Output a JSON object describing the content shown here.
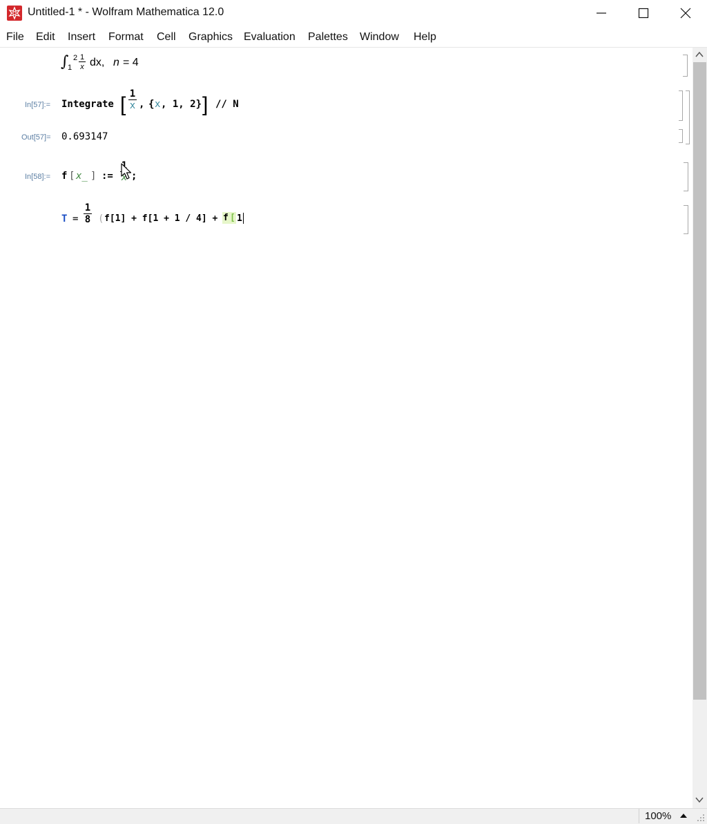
{
  "window": {
    "title": "Untitled-1 * - Wolfram Mathematica 12.0",
    "icon": "mathematica-spikey-icon",
    "accent": "#d3282c"
  },
  "menu": [
    "File",
    "Edit",
    "Insert",
    "Format",
    "Cell",
    "Graphics",
    "Evaluation",
    "Palettes",
    "Window",
    "Help"
  ],
  "cells": {
    "text_cell": {
      "integral_sign": "∫",
      "lower": "1",
      "upper": "2",
      "num": "1",
      "den": "x",
      "dx": "dx,",
      "n_var": "n",
      "eq": "= 4"
    },
    "in57": {
      "label": "In[57]:=",
      "func": "Integrate",
      "num": "1",
      "den": "x",
      "comma": ",",
      "list_open": "{",
      "var": "x",
      "list_rest": ", 1, 2}",
      "postfix": "// N"
    },
    "out57": {
      "label": "Out[57]=",
      "value": "0.693147"
    },
    "in58": {
      "label": "In[58]:=",
      "f": "f",
      "lb": "[",
      "pattern": "x_",
      "rb": "]",
      "assign": ":=",
      "num": "1",
      "den": "x",
      "semi": ";"
    },
    "tcell": {
      "T": "T",
      "eq": "=",
      "num": "1",
      "den": "8",
      "paren": "(",
      "terms": "f[1] + f[1 + 1 / 4] +",
      "f_last": "f",
      "lb_last": "[",
      "one_last": "1"
    }
  },
  "status": {
    "zoom": "100%"
  }
}
